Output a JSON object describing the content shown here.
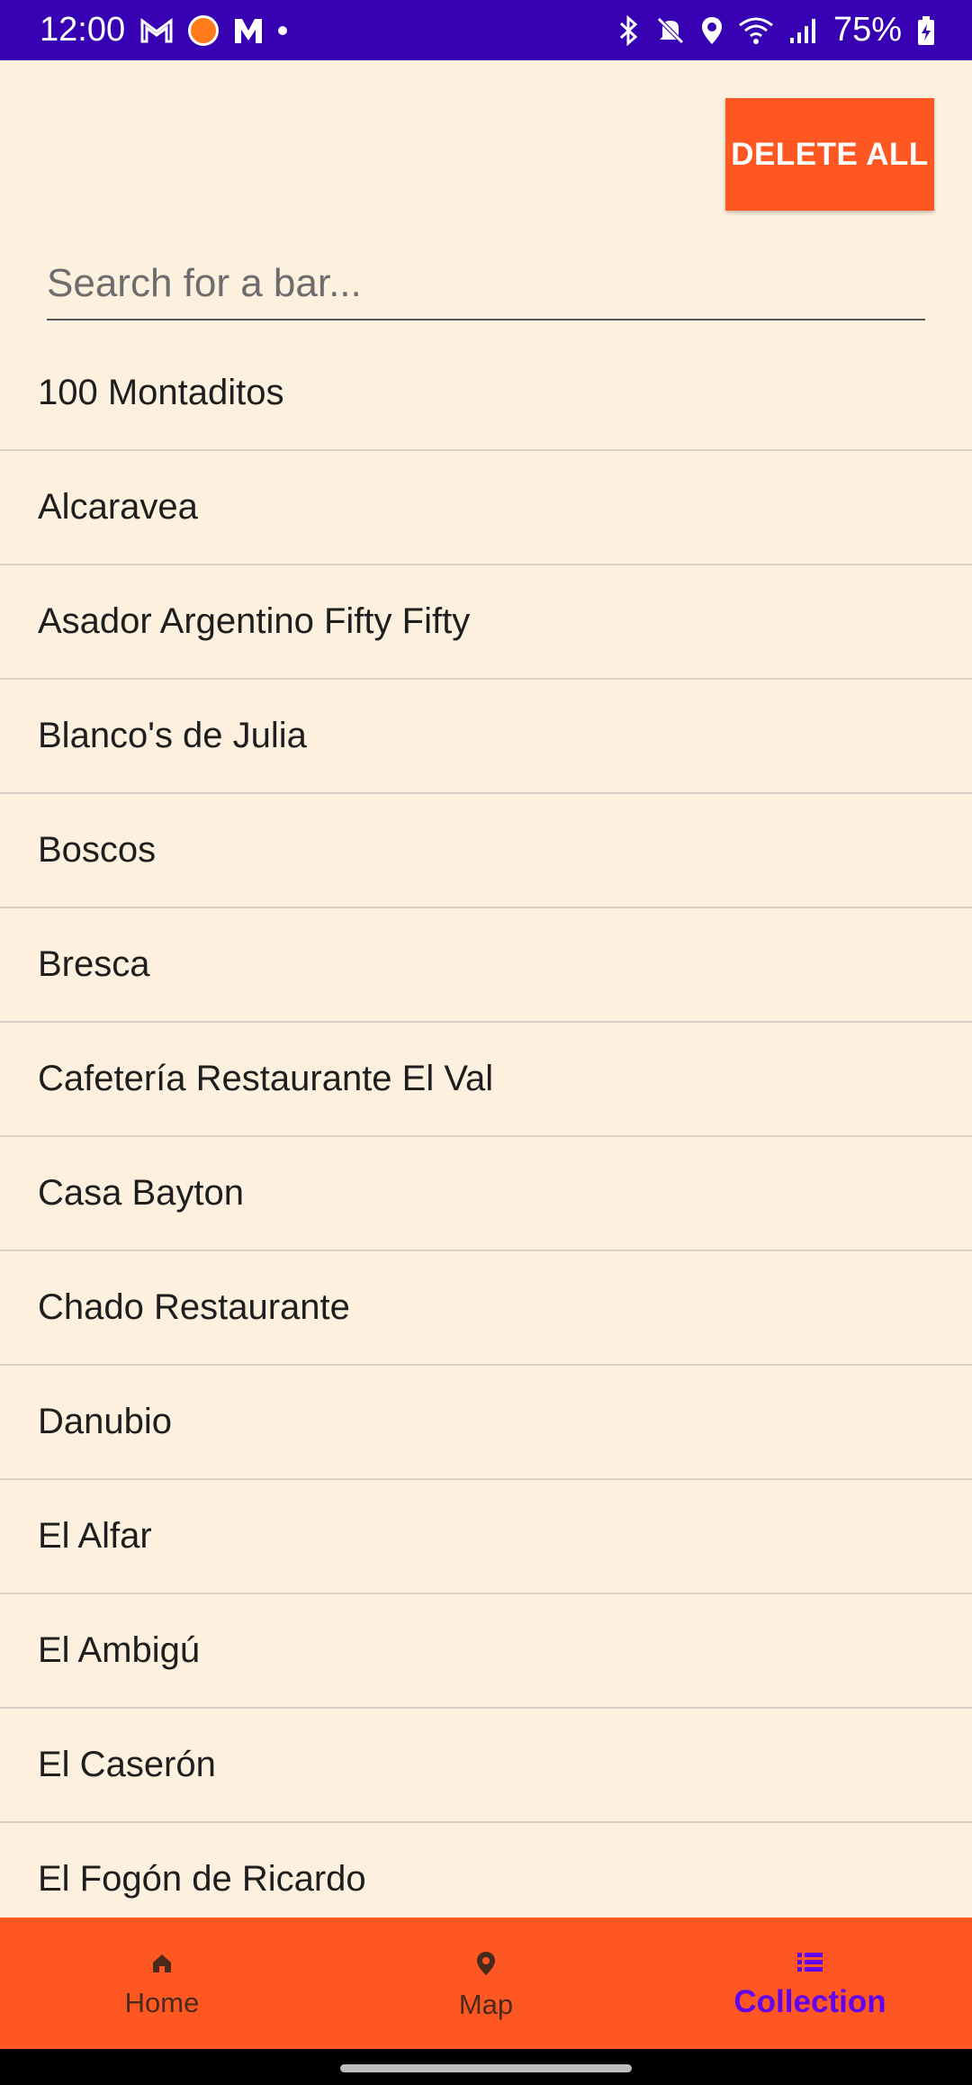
{
  "status_bar": {
    "time": "12:00",
    "battery": "75%",
    "icons_left": [
      "gmail-icon",
      "app-icon",
      "m-icon",
      "dot-icon"
    ],
    "icons_right": [
      "bluetooth-icon",
      "mute-icon",
      "location-icon",
      "wifi-icon",
      "signal-icon",
      "battery-icon"
    ]
  },
  "toolbar": {
    "delete_all_label": "DELETE ALL"
  },
  "search": {
    "placeholder": "Search for a bar...",
    "value": ""
  },
  "list": {
    "items": [
      "100 Montaditos",
      "Alcaravea",
      "Asador Argentino Fifty Fifty",
      "Blanco's de Julia",
      "Boscos",
      "Bresca",
      "Cafetería Restaurante El Val",
      "Casa Bayton",
      "Chado Restaurante",
      "Danubio",
      "El Alfar",
      "El Ambigú",
      "El Caserón",
      "El Fogón de Ricardo"
    ]
  },
  "bottom_nav": {
    "items": [
      {
        "label": "Home",
        "icon": "home-icon",
        "active": false
      },
      {
        "label": "Map",
        "icon": "map-pin-icon",
        "active": false
      },
      {
        "label": "Collection",
        "icon": "list-icon",
        "active": true
      }
    ]
  },
  "colors": {
    "status_bar": "#3700b3",
    "accent": "#ff5722",
    "background": "#fdf0df",
    "active_nav": "#6200ee"
  }
}
